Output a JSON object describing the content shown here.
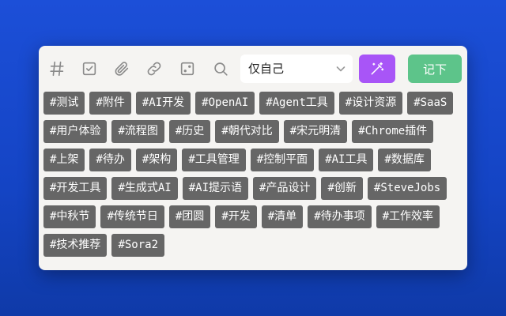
{
  "toolbar": {
    "icons": [
      "hash-icon",
      "checkbox-icon",
      "paperclip-icon",
      "link-icon",
      "dice-icon",
      "search-icon"
    ],
    "visibility_select": {
      "value": "仅自己"
    },
    "submit_label": "记下",
    "colors": {
      "magic": "#a855f7",
      "submit": "#5dc48a",
      "tag": "#666666"
    }
  },
  "tags": [
    "#测试",
    "#附件",
    "#AI开发",
    "#OpenAI",
    "#Agent工具",
    "#设计资源",
    "#SaaS",
    "#用户体验",
    "#流程图",
    "#历史",
    "#朝代对比",
    "#宋元明清",
    "#Chrome插件",
    "#上架",
    "#待办",
    "#架构",
    "#工具管理",
    "#控制平面",
    "#AI工具",
    "#数据库",
    "#开发工具",
    "#生成式AI",
    "#AI提示语",
    "#产品设计",
    "#创新",
    "#SteveJobs",
    "#中秋节",
    "#传统节日",
    "#团圆",
    "#开发",
    "#清单",
    "#待办事项",
    "#工作效率",
    "#技术推荐",
    "#Sora2"
  ]
}
